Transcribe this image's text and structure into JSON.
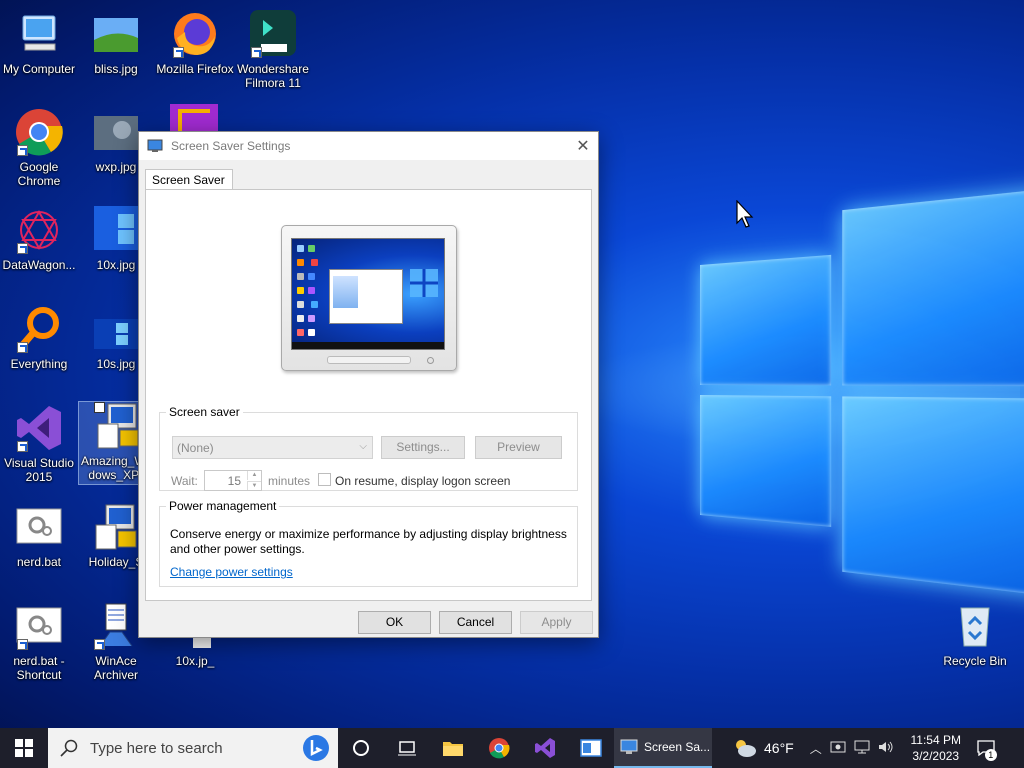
{
  "desktop": {
    "icons": [
      {
        "label": "My Computer"
      },
      {
        "label": "bliss.jpg"
      },
      {
        "label": "Mozilla Firefox"
      },
      {
        "label": "Wondershare Filmora 11"
      },
      {
        "label": "Google Chrome"
      },
      {
        "label": "wxp.jpg"
      },
      {
        "label": "DataWagon..."
      },
      {
        "label": "10x.jpg"
      },
      {
        "label": "Everything"
      },
      {
        "label": "10s.jpg"
      },
      {
        "label": "Visual Studio 2015"
      },
      {
        "label": "Amazing_Windows_XP.e"
      },
      {
        "label": "nerd.bat"
      },
      {
        "label": "Holiday_S"
      },
      {
        "label": "nerd.bat - Shortcut"
      },
      {
        "label": "WinAce Archiver"
      },
      {
        "label": "10x.jp_"
      },
      {
        "label": "Recycle Bin"
      }
    ]
  },
  "dialog": {
    "title": "Screen Saver Settings",
    "tab": "Screen Saver",
    "screen_saver": {
      "legend": "Screen saver",
      "selected": "(None)",
      "settings_label": "Settings...",
      "preview_label": "Preview",
      "wait_label": "Wait:",
      "wait_value": "15",
      "minutes_label": "minutes",
      "resume_label": "On resume, display logon screen"
    },
    "power": {
      "legend": "Power management",
      "text": "Conserve energy or maximize performance by adjusting display brightness and other power settings.",
      "link": "Change power settings"
    },
    "ok_label": "OK",
    "cancel_label": "Cancel",
    "apply_label": "Apply"
  },
  "taskbar": {
    "search_placeholder": "Type here to search",
    "active_app": "Screen Sa...",
    "weather": "46°F",
    "time": "11:54 PM",
    "date": "3/2/2023",
    "notifications": "1"
  },
  "colors": {
    "accent": "#0066cc",
    "taskbar": "#1e1f2b"
  }
}
